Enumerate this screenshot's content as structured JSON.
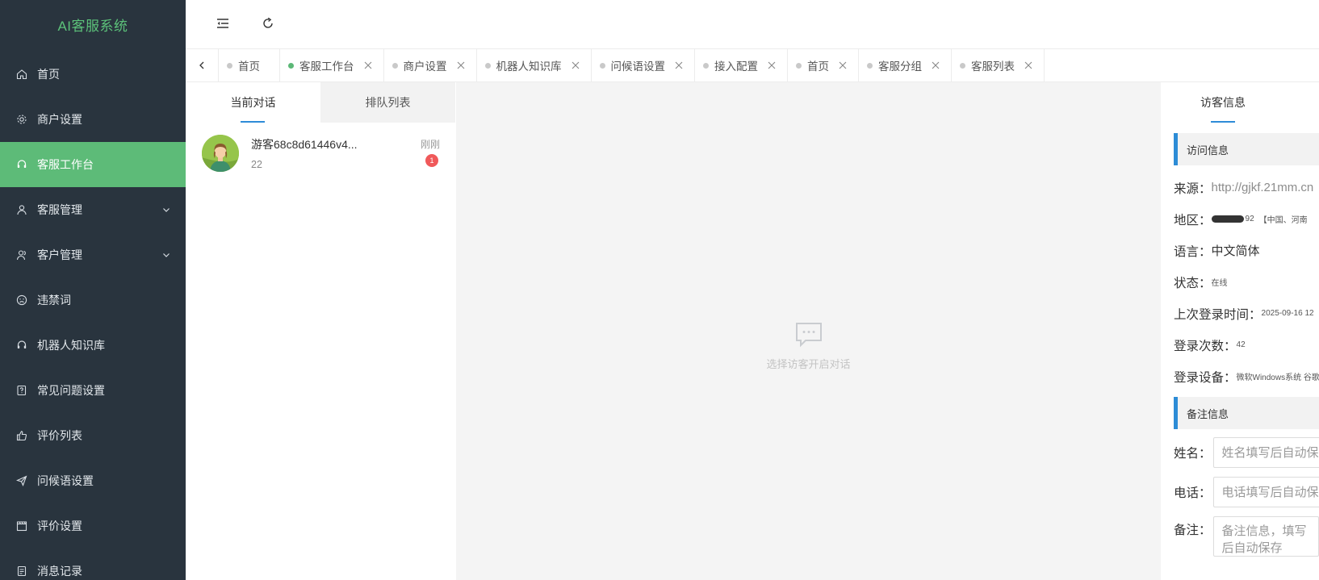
{
  "app": {
    "title": "AI客服系统"
  },
  "sidebar": {
    "items": [
      {
        "label": "首页",
        "icon": "home-icon",
        "active": false
      },
      {
        "label": "商户设置",
        "icon": "gear-icon",
        "active": false
      },
      {
        "label": "客服工作台",
        "icon": "headset-icon",
        "active": true
      },
      {
        "label": "客服管理",
        "icon": "user-icon",
        "active": false,
        "expandable": true
      },
      {
        "label": "客户管理",
        "icon": "users-icon",
        "active": false,
        "expandable": true
      },
      {
        "label": "违禁词",
        "icon": "frown-icon",
        "active": false
      },
      {
        "label": "机器人知识库",
        "icon": "headset-icon",
        "active": false
      },
      {
        "label": "常见问题设置",
        "icon": "question-doc-icon",
        "active": false
      },
      {
        "label": "评价列表",
        "icon": "thumbs-up-icon",
        "active": false
      },
      {
        "label": "问候语设置",
        "icon": "send-icon",
        "active": false
      },
      {
        "label": "评价设置",
        "icon": "clapper-icon",
        "active": false
      },
      {
        "label": "消息记录",
        "icon": "doc-icon",
        "active": false
      }
    ]
  },
  "topbar": {
    "collapse_icon": "menu-fold-icon",
    "refresh_icon": "refresh-icon"
  },
  "tabs": [
    {
      "label": "首页",
      "active": false,
      "closable": false
    },
    {
      "label": "客服工作台",
      "active": true,
      "closable": true
    },
    {
      "label": "商户设置",
      "active": false,
      "closable": true
    },
    {
      "label": "机器人知识库",
      "active": false,
      "closable": true
    },
    {
      "label": "问候语设置",
      "active": false,
      "closable": true
    },
    {
      "label": "接入配置",
      "active": false,
      "closable": true
    },
    {
      "label": "首页",
      "active": false,
      "closable": true
    },
    {
      "label": "客服分组",
      "active": false,
      "closable": true
    },
    {
      "label": "客服列表",
      "active": false,
      "closable": true
    }
  ],
  "conversations": {
    "tabs": [
      "当前对话",
      "排队列表"
    ],
    "items": [
      {
        "name": "游客68c8d61446v4...",
        "sub": "22",
        "time": "刚刚",
        "badge": "1"
      }
    ]
  },
  "chat": {
    "empty_text": "选择访客开启对话"
  },
  "visitor": {
    "tab_label": "访客信息",
    "visit_section": "访问信息",
    "source_label": "来源：",
    "source_value": "http://gjkf.21mm.cn",
    "region_label": "地区：",
    "region_ip_suffix": "92",
    "region_value": "【中国、河南",
    "language_label": "语言：",
    "language_value": "中文简体",
    "status_label": "状态：",
    "status_value": "在线",
    "last_login_label": "上次登录时间：",
    "last_login_value": "2025-09-16 12",
    "login_count_label": "登录次数：",
    "login_count_value": "42",
    "device_label": "登录设备：",
    "device_value": "微软Windows系统 谷歌",
    "note_section": "备注信息",
    "name_label": "姓名：",
    "name_placeholder": "姓名填写后自动保存",
    "phone_label": "电话：",
    "phone_placeholder": "电话填写后自动保存",
    "remark_label": "备注：",
    "remark_placeholder": "备注信息，填写后自动保存"
  },
  "colors": {
    "sidebar_bg": "#29343e",
    "accent_green": "#5dbb78",
    "accent_blue": "#2d8cd6",
    "badge_red": "#f0595a"
  }
}
